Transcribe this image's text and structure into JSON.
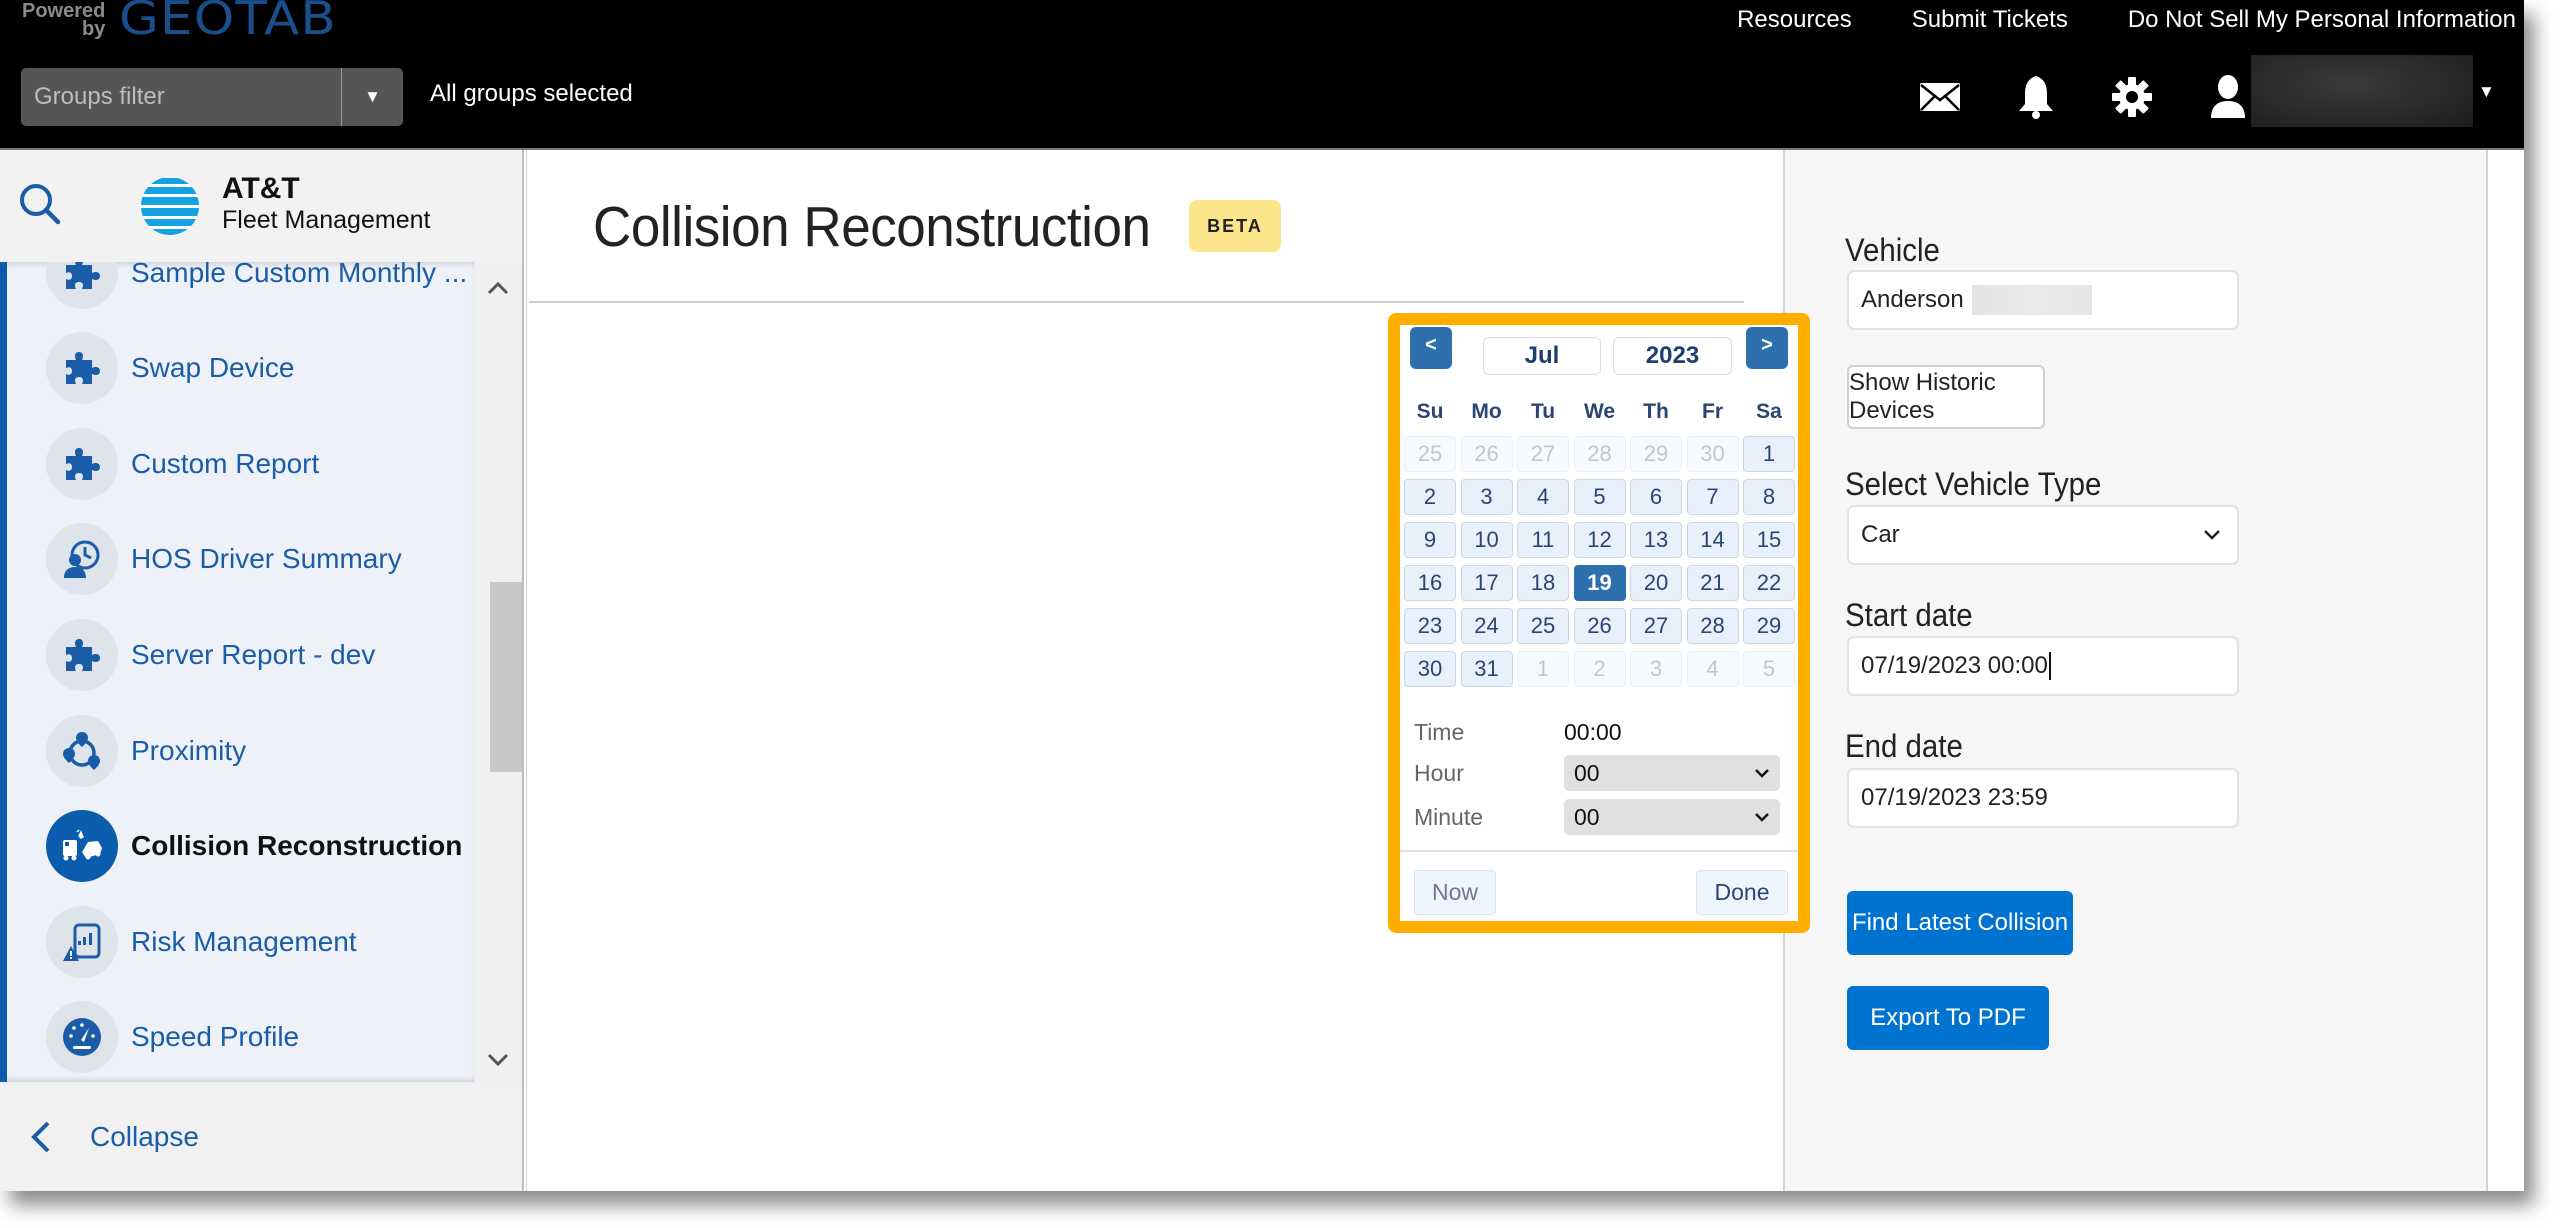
{
  "header": {
    "brand_powered": "Powered by",
    "brand_name": "GEOTAB",
    "groups_filter_placeholder": "Groups filter",
    "groups_status": "All groups selected",
    "links": [
      "Resources",
      "Submit Tickets",
      "Do Not Sell My Personal Information"
    ],
    "icons": [
      "mail-icon",
      "bell-icon",
      "gear-icon",
      "user-icon"
    ]
  },
  "sidebar": {
    "logo_title": "AT&T",
    "logo_subtitle": "Fleet Management",
    "items": [
      {
        "label": "Sample Custom Monthly ...",
        "icon": "puzzle-icon",
        "active": false
      },
      {
        "label": "Swap Device",
        "icon": "puzzle-icon",
        "active": false
      },
      {
        "label": "Custom Report",
        "icon": "puzzle-icon",
        "active": false
      },
      {
        "label": "HOS Driver Summary",
        "icon": "driver-clock-icon",
        "active": false
      },
      {
        "label": "Server Report - dev",
        "icon": "puzzle-icon",
        "active": false
      },
      {
        "label": "Proximity",
        "icon": "proximity-icon",
        "active": false
      },
      {
        "label": "Collision Reconstruction",
        "icon": "collision-icon",
        "active": true
      },
      {
        "label": "Risk Management",
        "icon": "risk-report-icon",
        "active": false
      },
      {
        "label": "Speed Profile",
        "icon": "speedometer-icon",
        "active": false
      }
    ],
    "collapse_label": "Collapse"
  },
  "main": {
    "title": "Collision Reconstruction",
    "badge": "BETA"
  },
  "calendar": {
    "prev_label": "<",
    "next_label": ">",
    "month": "Jul",
    "year": "2023",
    "weekdays": [
      "Su",
      "Mo",
      "Tu",
      "We",
      "Th",
      "Fr",
      "Sa"
    ],
    "days": [
      {
        "d": "25",
        "other": true
      },
      {
        "d": "26",
        "other": true
      },
      {
        "d": "27",
        "other": true
      },
      {
        "d": "28",
        "other": true
      },
      {
        "d": "29",
        "other": true
      },
      {
        "d": "30",
        "other": true
      },
      {
        "d": "1"
      },
      {
        "d": "2"
      },
      {
        "d": "3"
      },
      {
        "d": "4"
      },
      {
        "d": "5"
      },
      {
        "d": "6"
      },
      {
        "d": "7"
      },
      {
        "d": "8"
      },
      {
        "d": "9"
      },
      {
        "d": "10"
      },
      {
        "d": "11"
      },
      {
        "d": "12"
      },
      {
        "d": "13"
      },
      {
        "d": "14"
      },
      {
        "d": "15"
      },
      {
        "d": "16"
      },
      {
        "d": "17"
      },
      {
        "d": "18"
      },
      {
        "d": "19",
        "selected": true
      },
      {
        "d": "20"
      },
      {
        "d": "21"
      },
      {
        "d": "22"
      },
      {
        "d": "23"
      },
      {
        "d": "24"
      },
      {
        "d": "25"
      },
      {
        "d": "26"
      },
      {
        "d": "27"
      },
      {
        "d": "28"
      },
      {
        "d": "29"
      },
      {
        "d": "30"
      },
      {
        "d": "31"
      },
      {
        "d": "1",
        "other": true
      },
      {
        "d": "2",
        "other": true
      },
      {
        "d": "3",
        "other": true
      },
      {
        "d": "4",
        "other": true
      },
      {
        "d": "5",
        "other": true
      }
    ],
    "time_label": "Time",
    "time_value": "00:00",
    "hour_label": "Hour",
    "hour_value": "00",
    "minute_label": "Minute",
    "minute_value": "00",
    "now_label": "Now",
    "done_label": "Done",
    "highlight_color": "#ffae00",
    "selected_color": "#2e6fae"
  },
  "panel": {
    "vehicle_label": "Vehicle",
    "vehicle_value": "Anderson",
    "show_historic_label": "Show Historic Devices",
    "vehicle_type_label": "Select Vehicle Type",
    "vehicle_type_value": "Car",
    "start_date_label": "Start date",
    "start_date_value": "07/19/2023 00:00",
    "end_date_label": "End date",
    "end_date_value": "07/19/2023 23:59",
    "find_latest_label": "Find Latest Collision",
    "export_pdf_label": "Export To PDF",
    "primary_color": "#0073d1"
  }
}
